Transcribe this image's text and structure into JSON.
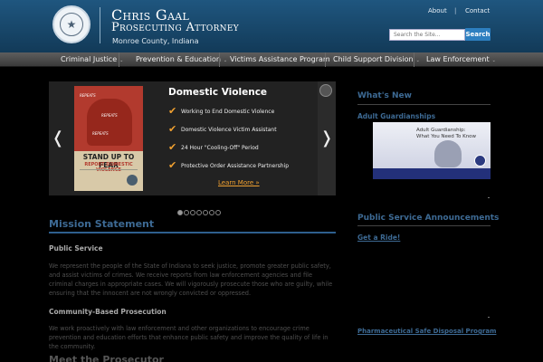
{
  "header": {
    "title_line1": "Chris Gaal",
    "title_line2": "Prosecuting Attorney",
    "subtitle": "Monroe County, Indiana",
    "links": [
      "About",
      "Contact"
    ],
    "link_separator": "|",
    "search_placeholder": "Search the Site...",
    "search_button": "Search",
    "seal_icon": "county-seal-icon"
  },
  "nav": {
    "items": [
      {
        "label": "Criminal Justice"
      },
      {
        "label": "Prevention & Education"
      },
      {
        "label": "Victims Assistance Program"
      },
      {
        "label": "Child Support Division"
      },
      {
        "label": "Law Enforcement"
      }
    ],
    "chevron": "⌄"
  },
  "slider": {
    "prev": "❬",
    "next": "❭",
    "title": "Domestic Violence",
    "items": [
      "Working to End Domestic Violence",
      "Domestic Violence Victim Assistant",
      "24 Hour \"Cooling-Off\" Period",
      "Protective Order Assistance Partnership"
    ],
    "check_glyph": "✔",
    "learn_more": "Learn More »",
    "poster": {
      "lines": [
        "REPEATS",
        "REPEATS",
        "REPEATS"
      ],
      "headline": "STAND UP TO FEAR",
      "subhead": "REPORT DOMESTIC VIOLENCE"
    },
    "dot_count": 7,
    "active_dot": 0
  },
  "main": {
    "mission_heading": "Mission Statement",
    "sections": [
      {
        "heading": "Public Service",
        "text": "We represent the people of the State of Indiana to seek justice, promote greater public safety, and assist victims of crimes. We receive reports from law enforcement agencies and file criminal charges in appropriate cases. We will vigorously prosecute those who are guilty, while ensuring that the innocent are not wrongly convicted or oppressed."
      },
      {
        "heading": "Community-Based Prosecution",
        "text": "We work proactively with law enforcement and other organizations to encourage crime prevention and education efforts that enhance public safety and improve the quality of life in the community."
      }
    ],
    "meet_heading": "Meet the Prosecutor"
  },
  "sidebar": {
    "whats_new": "What's New",
    "adult_guardianships": "Adult Guardianships",
    "banner_line1": "Adult Guardianship:",
    "banner_line2": "What You Need To Know",
    "psa_heading": "Public Service Announcements",
    "get_a_ride": "Get a Ride!",
    "pharma": "Pharmaceutical Safe Disposal Program"
  },
  "colors": {
    "accent_blue": "#3d6a94",
    "header_blue": "#1f567f",
    "orange": "#f0a030",
    "background": "#000000"
  }
}
